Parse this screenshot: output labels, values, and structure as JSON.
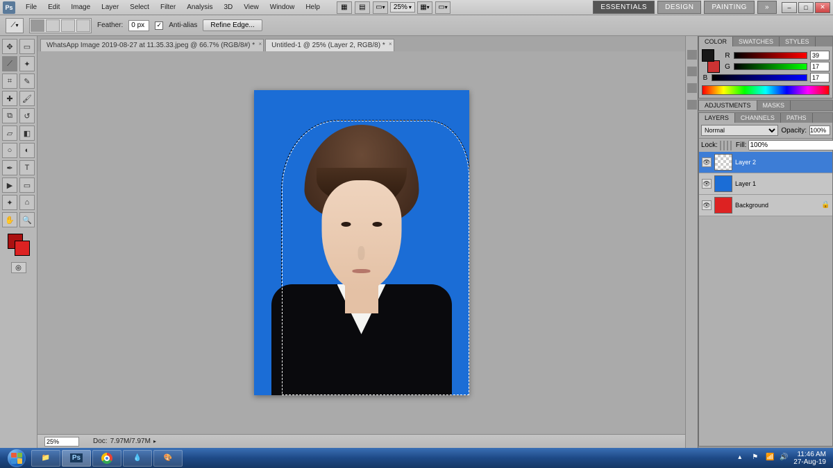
{
  "menubar": {
    "items": [
      "File",
      "Edit",
      "Image",
      "Layer",
      "Select",
      "Filter",
      "Analysis",
      "3D",
      "View",
      "Window",
      "Help"
    ],
    "zoom": "25%",
    "workspaces": [
      "ESSENTIALS",
      "DESIGN",
      "PAINTING"
    ],
    "more": "»"
  },
  "options": {
    "feather_label": "Feather:",
    "feather_value": "0 px",
    "antialias_label": "Anti-alias",
    "antialias_checked": true,
    "refine_edge": "Refine Edge..."
  },
  "tabs": [
    {
      "label": "WhatsApp Image 2019-08-27 at 11.35.33.jpeg @ 66.7% (RGB/8#) *",
      "active": false
    },
    {
      "label": "Untitled-1 @ 25% (Layer 2, RGB/8) *",
      "active": true
    }
  ],
  "status": {
    "zoom": "25%",
    "doc_label": "Doc:",
    "doc_size": "7.97M/7.97M"
  },
  "panels": {
    "color": {
      "tabs": [
        "COLOR",
        "SWATCHES",
        "STYLES"
      ],
      "r": "39",
      "g": "17",
      "b": "17"
    },
    "adjustments": {
      "tabs": [
        "ADJUSTMENTS",
        "MASKS"
      ]
    },
    "layers": {
      "tabs": [
        "LAYERS",
        "CHANNELS",
        "PATHS"
      ],
      "blend": "Normal",
      "opacity_label": "Opacity:",
      "opacity": "100%",
      "lock_label": "Lock:",
      "fill_label": "Fill:",
      "fill": "100%",
      "items": [
        {
          "name": "Layer 2",
          "selected": true,
          "thumb": "trans"
        },
        {
          "name": "Layer 1",
          "selected": false,
          "thumb": "ph"
        },
        {
          "name": "Background",
          "selected": false,
          "thumb": "bg",
          "locked": true
        }
      ]
    }
  },
  "taskbar": {
    "time": "11:46 AM",
    "date": "27-Aug-19"
  }
}
